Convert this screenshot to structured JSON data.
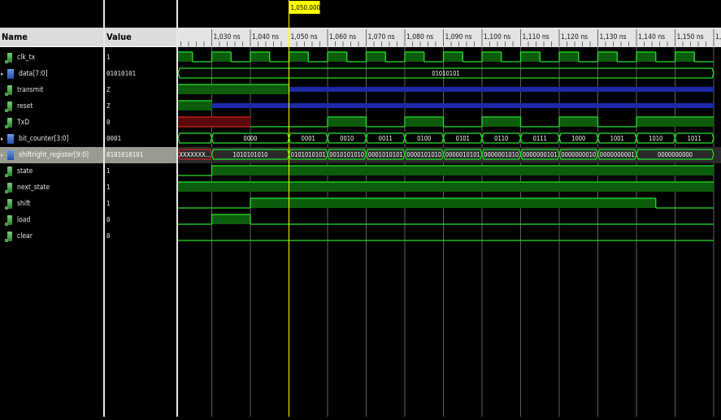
{
  "columns": {
    "name": "Name",
    "value": "Value"
  },
  "cursor": {
    "label": "1,050.000 ns"
  },
  "ruler": {
    "ticks": [
      "1,030 ns",
      "1,040 ns",
      "1,050 ns",
      "1,060 ns",
      "1,070 ns",
      "1,080 ns",
      "1,090 ns",
      "1,100 ns",
      "1,110 ns",
      "1,120 ns",
      "1,130 ns",
      "1,140 ns",
      "1,150 ns",
      "1,1"
    ]
  },
  "signals": [
    {
      "name": "clk_tx",
      "value": "1",
      "kind": "bit"
    },
    {
      "name": "data[7:0]",
      "value": "01010101",
      "kind": "bus"
    },
    {
      "name": "transmit",
      "value": "Z",
      "kind": "bit"
    },
    {
      "name": "reset",
      "value": "Z",
      "kind": "bit"
    },
    {
      "name": "TxD",
      "value": "0",
      "kind": "bit"
    },
    {
      "name": "bit_counter[3:0]",
      "value": "0001",
      "kind": "bus"
    },
    {
      "name": "shiftright_register[9:0]",
      "value": "0101010101",
      "kind": "bus",
      "selected": true
    },
    {
      "name": "state",
      "value": "1",
      "kind": "bit"
    },
    {
      "name": "next_state",
      "value": "1",
      "kind": "bit"
    },
    {
      "name": "shift",
      "value": "1",
      "kind": "bit"
    },
    {
      "name": "load",
      "value": "0",
      "kind": "bit"
    },
    {
      "name": "clear",
      "value": "0",
      "kind": "bit"
    }
  ],
  "bus_values": {
    "data": "01010101",
    "bit_counter": [
      "0000",
      "0001",
      "0010",
      "0011",
      "0100",
      "0101",
      "0110",
      "0111",
      "1000",
      "1001",
      "1010",
      "1011"
    ],
    "shiftright_register": [
      "XXXXXXX...",
      "1010101010",
      "0101010101",
      "0010101010",
      "0001010101",
      "0000101010",
      "0000010101",
      "0000001010",
      "0000000101",
      "0000000010",
      "0000000001",
      "0000000000"
    ]
  },
  "colors": {
    "wave": "#22e22a",
    "fill": "#0d5c0d",
    "hiz": "#1a2aa8",
    "unknown": "#d82020",
    "cursor": "#ffff00"
  }
}
